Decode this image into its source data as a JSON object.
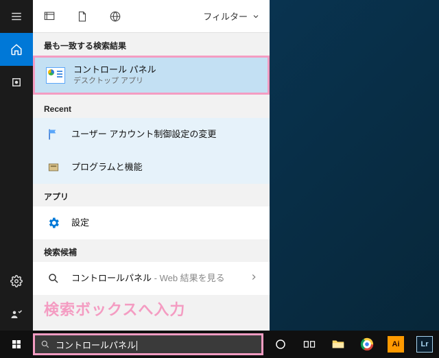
{
  "panel": {
    "filter_label": "フィルター",
    "sections": {
      "best_match": "最も一致する検索結果",
      "recent": "Recent",
      "apps": "アプリ",
      "suggestions": "検索候補"
    },
    "best": {
      "title": "コントロール パネル",
      "subtitle": "デスクトップ アプリ"
    },
    "recent_items": [
      {
        "label": "ユーザー アカウント制御設定の変更"
      },
      {
        "label": "プログラムと機能"
      }
    ],
    "apps_items": [
      {
        "label": "設定"
      }
    ],
    "suggestion": {
      "label": "コントロールパネル",
      "suffix": " - Web 結果を見る"
    }
  },
  "annotation": "検索ボックスへ入力",
  "search": {
    "value": "コントロールパネル"
  },
  "colors": {
    "accent": "#0078d7",
    "highlight_border": "#f49cc2",
    "best_bg": "#c3e0f3"
  },
  "taskbar_apps": [
    {
      "name": "task-view"
    },
    {
      "name": "file-explorer"
    },
    {
      "name": "chrome"
    },
    {
      "name": "illustrator"
    },
    {
      "name": "lightroom"
    }
  ]
}
